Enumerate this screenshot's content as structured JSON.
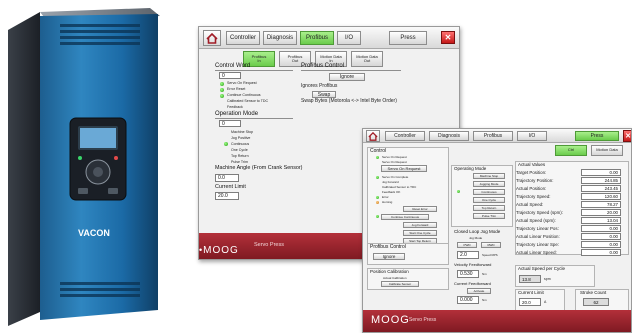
{
  "window_a": {
    "tabs": [
      {
        "label": "Controller",
        "active": false
      },
      {
        "label": "Diagnosis",
        "active": false
      },
      {
        "label": "Profibus",
        "active": true
      },
      {
        "label": "I/O",
        "active": false
      },
      {
        "label": "Press",
        "active": false
      }
    ],
    "subtabs": [
      {
        "label": "Profibus\nIn",
        "active": true
      },
      {
        "label": "Profibus\nOut",
        "active": false
      },
      {
        "label": "Motion Data\nIn",
        "active": false
      },
      {
        "label": "Motion Data\nOut",
        "active": false
      }
    ],
    "control_word": {
      "title": "Control Word",
      "value": "0"
    },
    "status_items": [
      {
        "label": "Servo On Request",
        "led": "green"
      },
      {
        "label": "Error Reset",
        "led": "green"
      },
      {
        "label": "Continue Continuous",
        "led": "green"
      },
      {
        "label": "Calibrated Sensor to TDC",
        "led": "off"
      },
      {
        "label": "Feedback",
        "led": "off"
      }
    ],
    "operation_mode": {
      "title": "Operation Mode",
      "value": "0"
    },
    "mode_items": [
      "Machine Stop",
      "Jog Positive",
      "Continuous",
      "One Cycle",
      "Top Return",
      "Pulse Trim"
    ],
    "machine_angle": {
      "title": "Machine Angle (From Crank Sensor)",
      "value": "0.0"
    },
    "current_limit": {
      "title": "Current Limit",
      "value": "20.0"
    },
    "profibus_control": {
      "title": "Profibus Control",
      "ignore_button": "Ignore",
      "ignores_label": "Ignores Profibus"
    },
    "swap": {
      "button": "Swap",
      "label": "Swap Bytes (Motorola <-> Intel Byte Order)"
    },
    "footer": {
      "logo": "MOOG",
      "tagline": "Servo Press"
    }
  },
  "window_b": {
    "tabs": [
      {
        "label": "Controller",
        "active": false
      },
      {
        "label": "Diagnosis",
        "active": false
      },
      {
        "label": "Profibus",
        "active": false
      },
      {
        "label": "I/O",
        "active": false
      },
      {
        "label": "Press",
        "active": true
      }
    ],
    "subtabs": [
      {
        "label": "Ctrl",
        "active": true
      },
      {
        "label": "Motion Data",
        "active": false
      }
    ],
    "control": {
      "title": "Control",
      "items": [
        {
          "label": "Servo On Request",
          "led": "green"
        },
        {
          "label": "Servo On Request",
          "led": "off"
        },
        {
          "label": "Servo On Request",
          "led": "off",
          "boxed": true
        },
        {
          "label": "Servo On Complete",
          "led": "green"
        },
        {
          "label": "Jog Forward",
          "led": "off"
        },
        {
          "label": "Calibrated Sensor to TDC",
          "led": "off"
        },
        {
          "label": "Feedback OK",
          "led": "off"
        },
        {
          "label": "Error",
          "led": "green"
        },
        {
          "label": "Homing",
          "led": "orange"
        },
        {
          "label": "Reset Error",
          "led": "off",
          "boxed": true
        },
        {
          "label": "Continue Continuous",
          "led": "green",
          "boxed": true
        },
        {
          "label": "Jog Forward",
          "led": "off",
          "boxed": true
        },
        {
          "label": "Start One Cycle",
          "led": "off",
          "boxed": true
        },
        {
          "label": "Start Top Return",
          "led": "off",
          "boxed": true
        }
      ]
    },
    "profibus_control": {
      "title": "Profibus Control",
      "button": "Ignore"
    },
    "position_calibration": {
      "title": "Position Calibration",
      "sub": "Actual Calibration",
      "button": "Calibrate Sensor"
    },
    "operating_mode": {
      "title": "Operating Mode",
      "items": [
        {
          "label": "Machine Stop",
          "led": "off"
        },
        {
          "label": "Jogging Mode",
          "led": "off"
        },
        {
          "label": "Continuous",
          "led": "green"
        },
        {
          "label": "One Cycle",
          "led": "off"
        },
        {
          "label": "Top Return",
          "led": "off"
        },
        {
          "label": "Pulse Trim",
          "led": "off"
        }
      ]
    },
    "closed_loop": {
      "title": "Closed Loop Jog Mode",
      "jog_label": "Jog Mode",
      "pwd": "PWD",
      "rwd": "RWD",
      "speed_value": "2.0",
      "speed_unit": "Speed RPS"
    },
    "velocity_ff": {
      "title": "Velocity Feedforward",
      "value": "0.530",
      "unit": "Nm"
    },
    "current_ff": {
      "title": "Current Feedforward",
      "button": "Activate",
      "value": "0.000",
      "unit": "Nm"
    },
    "actual_values": {
      "title": "Actual Values",
      "rows": [
        {
          "label": "Target Position:",
          "value": "0.00"
        },
        {
          "label": "Trajectory Position:",
          "value": "244.85"
        },
        {
          "label": "Actual Position:",
          "value": "243.45"
        },
        {
          "label": "Trajectory Speed:",
          "value": "120.60"
        },
        {
          "label": "Actual Speed:",
          "value": "78.27"
        },
        {
          "label": "Trajectory Speed (spm):",
          "value": "20.00"
        },
        {
          "label": "Actual Speed (spm):",
          "value": "13.04"
        },
        {
          "label": "Trajectory Linear Pos:",
          "value": "0.00"
        },
        {
          "label": "Actual Linear Position:",
          "value": "0.00"
        },
        {
          "label": "Trajectory Linear Spe:",
          "value": "0.00"
        },
        {
          "label": "Actual Linear Speed:",
          "value": "0.00"
        }
      ]
    },
    "actual_speed_cycle": {
      "title": "Actual Speed per Cycle",
      "value": "13.8",
      "unit": "spm"
    },
    "current_limit": {
      "title": "Current Limit",
      "value": "20.0",
      "unit": "A"
    },
    "stroke_count": {
      "title": "Stroke Count",
      "value": "62"
    },
    "footer": {
      "logo": "MOOG",
      "tagline": "Servo Press"
    }
  },
  "drive": {
    "brand": "VACON"
  }
}
